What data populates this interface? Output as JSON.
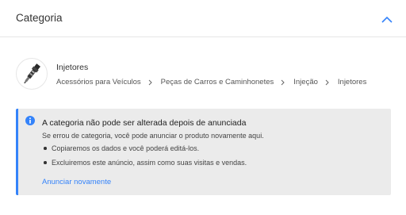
{
  "header": {
    "title": "Categoria",
    "toggle_icon": "chevron-up-icon"
  },
  "category": {
    "thumbnail": "injector-product-image",
    "name": "Injetores",
    "breadcrumb": [
      "Acessórios para Veículos",
      "Peças de Carros e Caminhonetes",
      "Injeção",
      "Injetores"
    ],
    "separator_icon": "chevron-right-icon"
  },
  "notice": {
    "icon": "info-icon",
    "title": "A categoria não pode ser alterada depois de anunciada",
    "subtitle": "Se errou de categoria, você pode anunciar o produto novamente aqui.",
    "bullets": [
      "Copiaremos os dados e você poderá editá-los.",
      "Excluiremos este anúncio, assim como suas visitas e vendas."
    ],
    "link_label": "Anunciar novamente"
  },
  "colors": {
    "accent": "#3483fa",
    "notice_background": "#ebebeb",
    "text": "#333333"
  }
}
